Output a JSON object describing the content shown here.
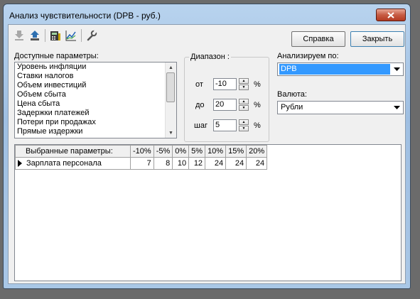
{
  "window": {
    "title": "Анализ чувствительности (DPB - руб.)"
  },
  "toolbar": {
    "icons": [
      "download-icon",
      "upload-icon",
      "calculator-icon",
      "chart-icon",
      "wrench-icon"
    ]
  },
  "buttons": {
    "help": "Справка",
    "close": "Закрыть"
  },
  "params": {
    "label": "Доступные параметры:",
    "items": [
      "Уровень инфляции",
      "Ставки налогов",
      "Объем инвестиций",
      "Объем сбыта",
      "Цена сбыта",
      "Задержки платежей",
      "Потери при продажах",
      "Прямые издержки"
    ]
  },
  "range": {
    "title": "Диапазон :",
    "from_label": "от",
    "from_value": "-10",
    "to_label": "до",
    "to_value": "20",
    "step_label": "шаг",
    "step_value": "5",
    "unit": "%"
  },
  "analyze": {
    "label": "Анализируем по:",
    "value": "DPB"
  },
  "currency": {
    "label": "Валюта:",
    "value": "Рубли"
  },
  "grid": {
    "header_label": "Выбранные параметры:",
    "columns": [
      "-10%",
      "-5%",
      "0%",
      "5%",
      "10%",
      "15%",
      "20%"
    ],
    "rows": [
      {
        "name": "Зарплата персонала",
        "values": [
          "7",
          "8",
          "10",
          "12",
          "24",
          "24",
          "24"
        ]
      }
    ]
  },
  "colors": {
    "selection": "#3399ff",
    "titlebar": "#a9c7e6",
    "close": "#c75c44"
  }
}
